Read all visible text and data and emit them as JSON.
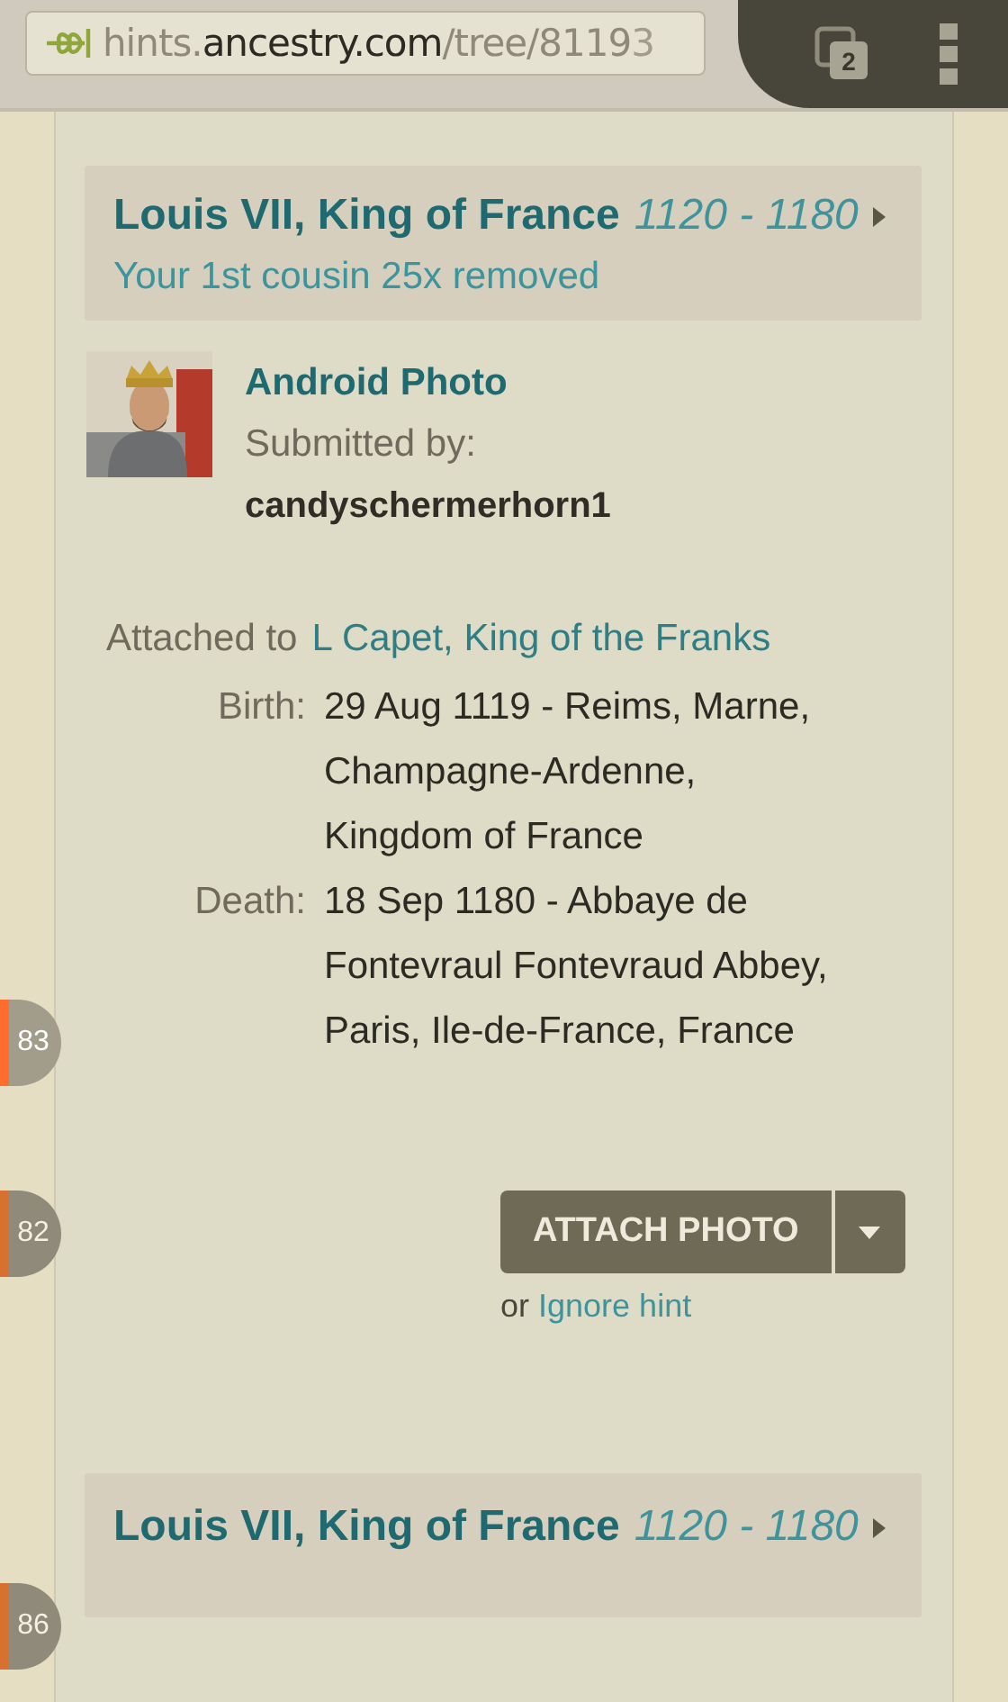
{
  "browser": {
    "url": [
      {
        "text": "hints.",
        "kind": "dim"
      },
      {
        "text": "ancestry.com",
        "kind": "host"
      },
      {
        "text": "/tree/8119",
        "kind": "dim"
      },
      {
        "text": "3",
        "kind": "fade"
      }
    ],
    "tab_count": "2"
  },
  "markers": [
    {
      "label": "83",
      "active": true
    },
    {
      "label": "82",
      "active": false
    },
    {
      "label": "86",
      "active": false
    }
  ],
  "hints": [
    {
      "person": "Louis VII, King of France",
      "years": "1120 - 1180",
      "relation": "Your 1st cousin 25x removed",
      "photo_title": "Android Photo",
      "submitted_label": "Submitted by:",
      "submitter": "candyschermerhorn1",
      "attached_label": "Attached to",
      "attached_name": "L Capet, King of the Franks",
      "facts": [
        {
          "label": "Birth:",
          "value": "29 Aug 1119 - Reims, Marne, Champagne-Ardenne, Kingdom of France"
        },
        {
          "label": "Death:",
          "value": "18 Sep 1180 - Abbaye de Fontevraul Fontevraud Abbey, Paris, Ile-de-France, France"
        }
      ],
      "action": "ATTACH PHOTO",
      "or_text": "or",
      "ignore_link": "Ignore hint"
    },
    {
      "person": "Louis VII, King of France",
      "years": "1120 - 1180"
    }
  ]
}
